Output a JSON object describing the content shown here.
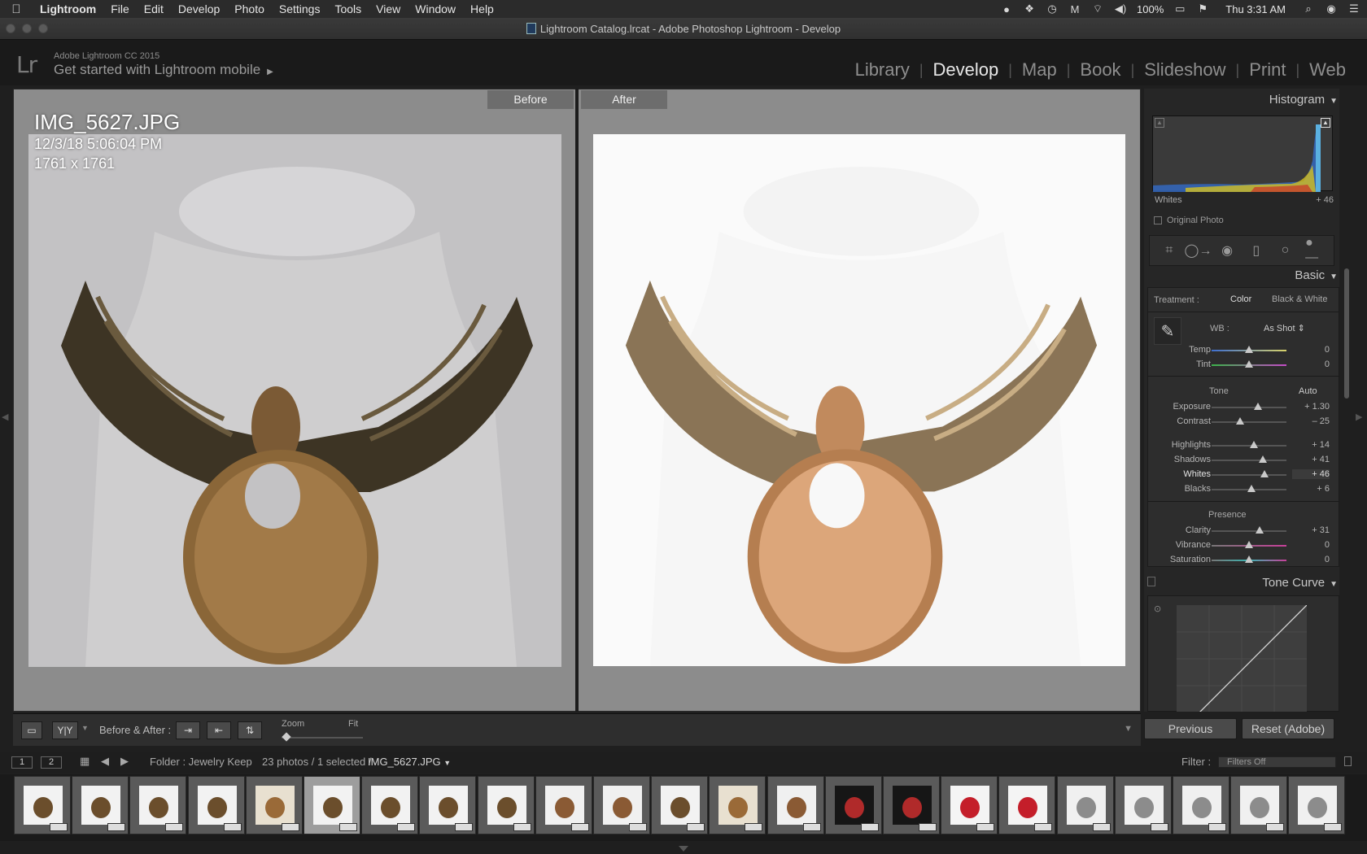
{
  "menubar": {
    "app_name": "Lightroom",
    "items": [
      "File",
      "Edit",
      "Develop",
      "Photo",
      "Settings",
      "Tools",
      "View",
      "Window",
      "Help"
    ],
    "battery": "100%",
    "clock": "Thu 3:31 AM"
  },
  "window": {
    "title": "Lightroom Catalog.lrcat - Adobe Photoshop Lightroom - Develop"
  },
  "identity": {
    "logo": "Lr",
    "product": "Adobe Lightroom CC 2015",
    "tagline": "Get started with Lightroom mobile"
  },
  "modules": [
    "Library",
    "Develop",
    "Map",
    "Book",
    "Slideshow",
    "Print",
    "Web"
  ],
  "active_module": "Develop",
  "compare": {
    "before_label": "Before",
    "after_label": "After",
    "filename": "IMG_5627.JPG",
    "datetime": "12/3/18 5:06:04 PM",
    "dimensions": "1761 x 1761"
  },
  "toolbar": {
    "before_after_label": "Before & After :",
    "zoom_label": "Zoom",
    "fit_label": "Fit"
  },
  "right_panel": {
    "histogram_title": "Histogram",
    "hist_hover_label": "Whites",
    "hist_hover_value": "+ 46",
    "original_photo": "Original Photo",
    "basic_title": "Basic",
    "treatment_label": "Treatment :",
    "treatment_color": "Color",
    "treatment_bw": "Black & White",
    "wb_label": "WB :",
    "wb_value": "As Shot",
    "tone_label": "Tone",
    "auto_label": "Auto",
    "presence_label": "Presence",
    "tone_curve_title": "Tone Curve",
    "sliders": [
      {
        "label": "Temp",
        "value": "0",
        "pos": 0.5
      },
      {
        "label": "Tint",
        "value": "0",
        "pos": 0.5
      },
      {
        "label": "Exposure",
        "value": "+ 1.30",
        "pos": 0.62
      },
      {
        "label": "Contrast",
        "value": "– 25",
        "pos": 0.38
      },
      {
        "label": "Highlights",
        "value": "+ 14",
        "pos": 0.56
      },
      {
        "label": "Shadows",
        "value": "+ 41",
        "pos": 0.68
      },
      {
        "label": "Whites",
        "value": "+ 46",
        "pos": 0.7
      },
      {
        "label": "Blacks",
        "value": "+ 6",
        "pos": 0.53
      },
      {
        "label": "Clarity",
        "value": "+ 31",
        "pos": 0.64
      },
      {
        "label": "Vibrance",
        "value": "0",
        "pos": 0.5
      },
      {
        "label": "Saturation",
        "value": "0",
        "pos": 0.5
      }
    ],
    "previous_btn": "Previous",
    "reset_btn": "Reset (Adobe)"
  },
  "filmstrip_bar": {
    "view1": "1",
    "view2": "2",
    "folder": "Folder : Jewelry Keep",
    "count": "23 photos / 1 selected /",
    "selected_file": "IMG_5627.JPG",
    "filter_label": "Filter :",
    "filter_value": "Filters Off"
  },
  "filmstrip": {
    "selected_index": 5,
    "thumbs": [
      "necklace",
      "necklace",
      "necklace",
      "necklace",
      "pendant",
      "necklace",
      "necklace",
      "necklace",
      "necklace",
      "earrings",
      "earrings",
      "necklace",
      "pendant",
      "earrings",
      "pendant-red",
      "pendant-red",
      "ring-red",
      "ring-red",
      "ring-silver",
      "ring-silver",
      "ring-silver",
      "ring-silver",
      "ring-silver"
    ]
  }
}
